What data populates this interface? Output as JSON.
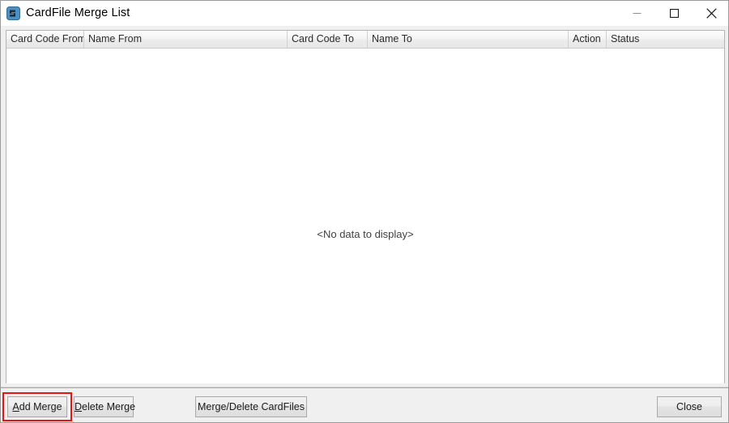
{
  "window": {
    "title": "CardFile Merge List",
    "icon": "cardfile-icon",
    "controls": {
      "minimize": "minimize-icon",
      "maximize": "maximize-icon",
      "close": "close-icon"
    }
  },
  "grid": {
    "columns": [
      {
        "id": "card-code-from",
        "label": "Card Code From"
      },
      {
        "id": "name-from",
        "label": "Name From"
      },
      {
        "id": "card-code-to",
        "label": "Card Code To"
      },
      {
        "id": "name-to",
        "label": "Name To"
      },
      {
        "id": "action",
        "label": "Action"
      },
      {
        "id": "status",
        "label": "Status"
      }
    ],
    "rows": [],
    "empty_message": "<No data to display>"
  },
  "footer": {
    "add_merge": {
      "label": "Add Merge",
      "accelerator": "A"
    },
    "delete_merge": {
      "label": "Delete Merge",
      "accelerator": "D"
    },
    "merge_delete_cardfiles": {
      "label": "Merge/Delete CardFiles"
    },
    "close": {
      "label": "Close"
    }
  },
  "annotation": {
    "highlight_target": "add-merge-button",
    "highlight_color": "#ee1111"
  }
}
